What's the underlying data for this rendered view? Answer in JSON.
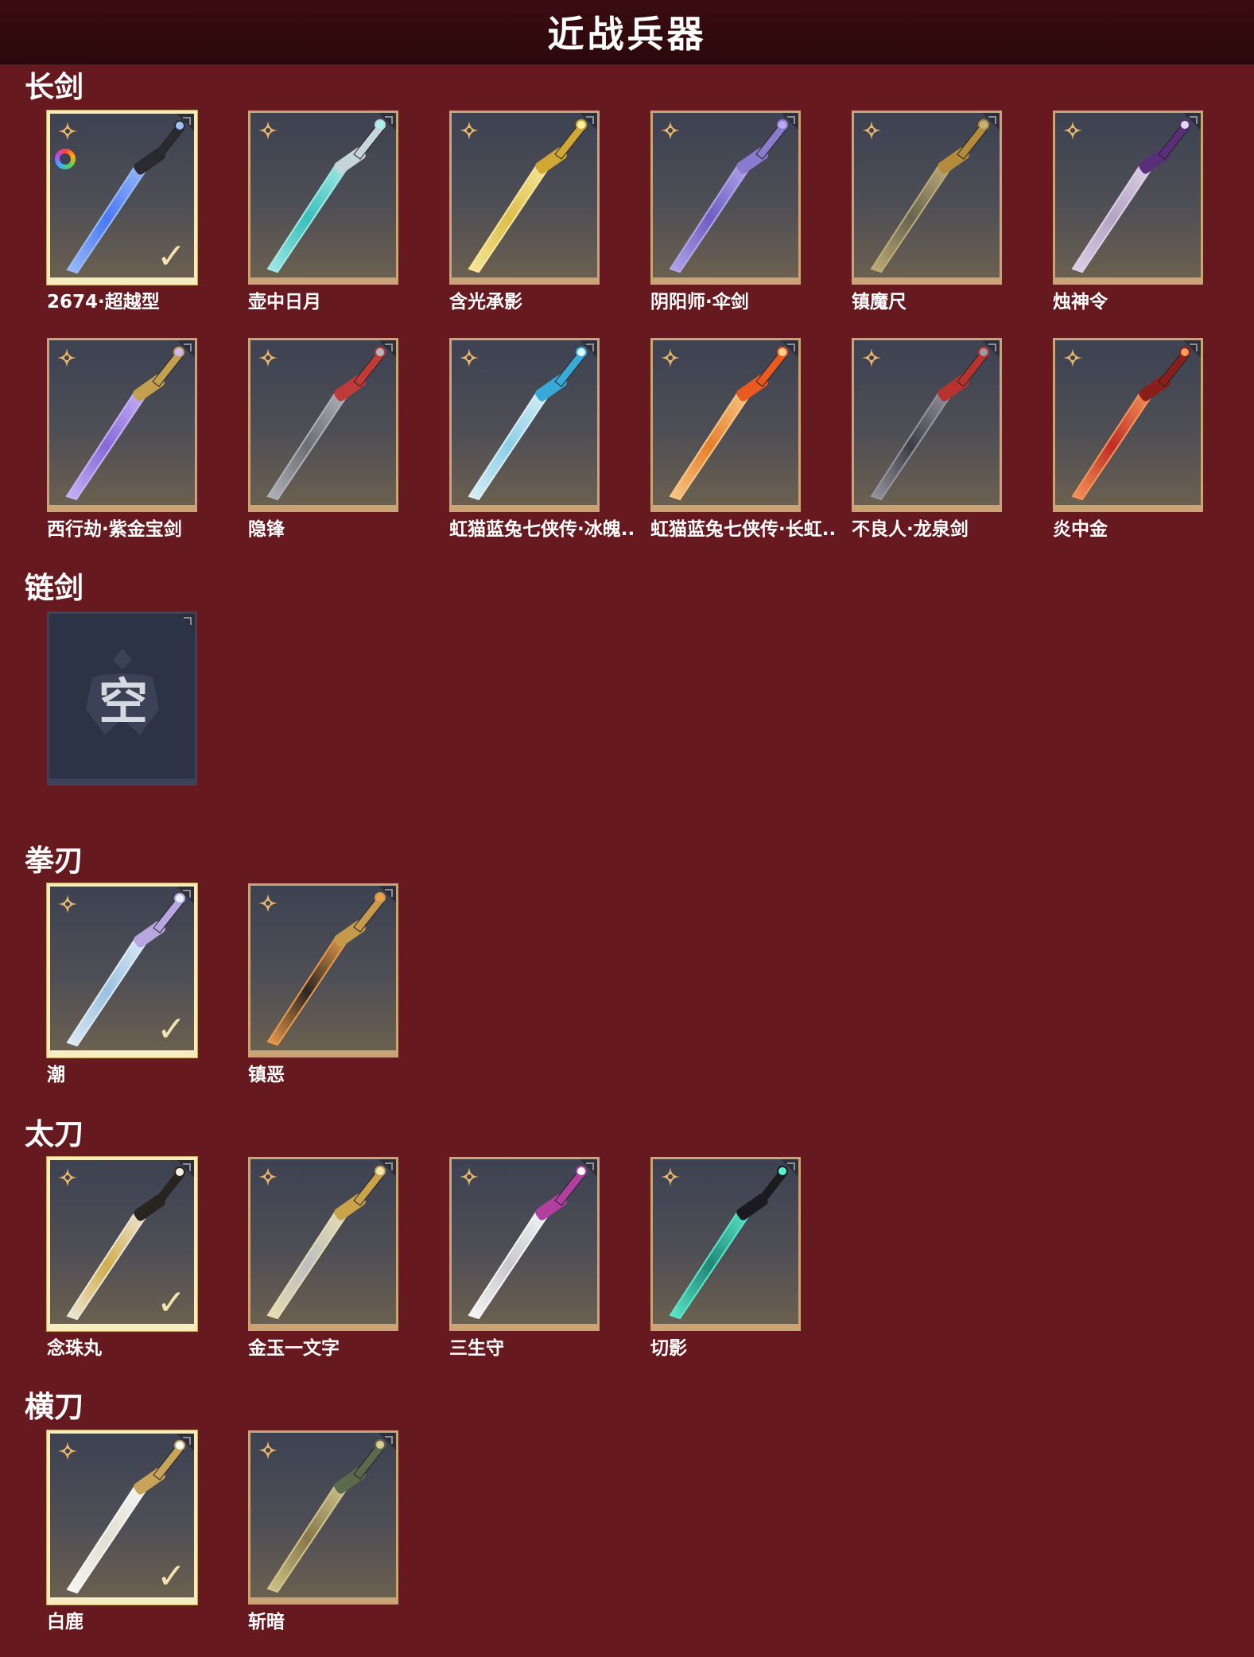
{
  "header": {
    "title": "近战兵器"
  },
  "categories": [
    {
      "title": "长剑",
      "items": [
        {
          "name": "2674·超越型",
          "equipped": true,
          "color_ring": true,
          "blade": "#4a7bff",
          "glow": "#9ec2ff",
          "hilt": "#2a2a30"
        },
        {
          "name": "壶中日月",
          "equipped": false,
          "blade": "#38c6c0",
          "glow": "#a8f2ee",
          "hilt": "#c6d4dc"
        },
        {
          "name": "含光承影",
          "equipped": false,
          "blade": "#e6c44a",
          "glow": "#fff1a0",
          "hilt": "#d0a732"
        },
        {
          "name": "阴阳师·伞剑",
          "equipped": false,
          "blade": "#6f5fc8",
          "glow": "#b9aaf2",
          "hilt": "#8a7bcf"
        },
        {
          "name": "镇魔尺",
          "equipped": false,
          "blade": "#6a6650",
          "glow": "#c4b27a",
          "hilt": "#b38b3a"
        },
        {
          "name": "烛神令",
          "equipped": false,
          "blade": "#b9a9c8",
          "glow": "#e5d7ef",
          "hilt": "#5a2f7a"
        }
      ]
    },
    {
      "title": "",
      "items": [
        {
          "name": "西行劫·紫金宝剑",
          "equipped": false,
          "blade": "#8a6be0",
          "glow": "#cfb8ff",
          "hilt": "#c2a050"
        },
        {
          "name": "隐锋",
          "equipped": false,
          "blade": "#6e7076",
          "glow": "#b5b8bf",
          "hilt": "#c03a38"
        },
        {
          "name": "虹猫蓝兔七侠传·冰魄..",
          "equipped": false,
          "blade": "#8fd6f0",
          "glow": "#e0f8ff",
          "hilt": "#39a9d8"
        },
        {
          "name": "虹猫蓝兔七侠传·长虹..",
          "equipped": false,
          "blade": "#f0802a",
          "glow": "#ffd08a",
          "hilt": "#ea5a1e"
        },
        {
          "name": "不良人·龙泉剑",
          "equipped": false,
          "blade": "#3c3c44",
          "glow": "#9a9aa6",
          "hilt": "#b8332e"
        },
        {
          "name": "炎中金",
          "equipped": false,
          "blade": "#c52c24",
          "glow": "#ff9a5a",
          "hilt": "#8a1e1a"
        }
      ]
    },
    {
      "title": "链剑",
      "items": [
        {
          "name": "",
          "empty": true,
          "empty_label": "空"
        }
      ]
    },
    {
      "title": "拳刃",
      "items": [
        {
          "name": "潮",
          "equipped": true,
          "blade": "#9ec8e8",
          "glow": "#e6f3ff",
          "hilt": "#b8a6e0"
        },
        {
          "name": "镇恶",
          "equipped": false,
          "blade": "#2a2522",
          "glow": "#f2a04a",
          "hilt": "#c59a4c"
        }
      ]
    },
    {
      "title": "太刀",
      "items": [
        {
          "name": "念珠丸",
          "equipped": true,
          "blade": "#d9b24a",
          "glow": "#f5f0e0",
          "hilt": "#2a2420"
        },
        {
          "name": "金玉一文字",
          "equipped": false,
          "blade": "#c2c4c8",
          "glow": "#f0e6b8",
          "hilt": "#c9a24a"
        },
        {
          "name": "三生守",
          "equipped": false,
          "blade": "#cfcfd4",
          "glow": "#ffffff",
          "hilt": "#b23fa0"
        },
        {
          "name": "切影",
          "equipped": false,
          "blade": "#1f8a7a",
          "glow": "#5af0d0",
          "hilt": "#1a1a20"
        }
      ]
    },
    {
      "title": "横刀",
      "items": [
        {
          "name": "白鹿",
          "equipped": true,
          "blade": "#eae6d8",
          "glow": "#ffffff",
          "hilt": "#c8a45a"
        },
        {
          "name": "斩暗",
          "equipped": false,
          "blade": "#8a7a4a",
          "glow": "#d8cc90",
          "hilt": "#5a6a4a"
        }
      ]
    }
  ],
  "ui": {
    "check_mark": "✓"
  },
  "colors": {
    "background": "#661a20",
    "card_border": "#caa474",
    "equipped_border": "#f6ecc0"
  }
}
